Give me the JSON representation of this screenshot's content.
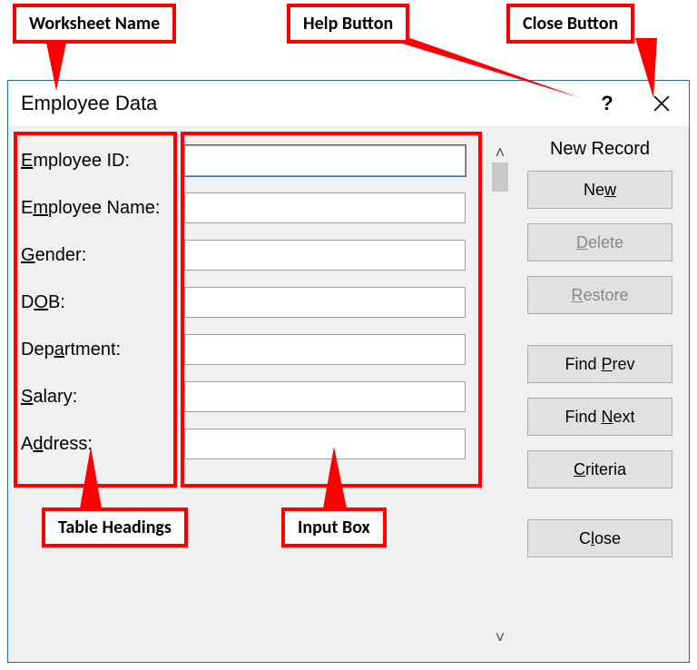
{
  "callouts": {
    "worksheet_name": "Worksheet Name",
    "help_button": "Help Button",
    "close_button": "Close Button",
    "table_headings": "Table Headings",
    "input_box": "Input Box"
  },
  "dialog": {
    "title": "Employee Data",
    "status": "New Record",
    "fields": [
      {
        "label": "Employee ID:",
        "accel": "E",
        "value": ""
      },
      {
        "label": "Employee Name:",
        "accel": "m",
        "value": ""
      },
      {
        "label": "Gender:",
        "accel": "G",
        "value": ""
      },
      {
        "label": "DOB:",
        "accel": "O",
        "value": ""
      },
      {
        "label": "Department:",
        "accel": "a",
        "value": ""
      },
      {
        "label": "Salary:",
        "accel": "S",
        "value": ""
      },
      {
        "label": "Address:",
        "accel": "d",
        "value": ""
      }
    ],
    "buttons": {
      "new": {
        "label": "New",
        "accel": "w",
        "enabled": true
      },
      "delete": {
        "label": "Delete",
        "accel": "D",
        "enabled": false
      },
      "restore": {
        "label": "Restore",
        "accel": "R",
        "enabled": false
      },
      "find_prev": {
        "label": "Find Prev",
        "accel": "P",
        "enabled": true
      },
      "find_next": {
        "label": "Find Next",
        "accel": "N",
        "enabled": true
      },
      "criteria": {
        "label": "Criteria",
        "accel": "C",
        "enabled": true
      },
      "close": {
        "label": "Close",
        "accel": "l",
        "enabled": true
      }
    }
  }
}
